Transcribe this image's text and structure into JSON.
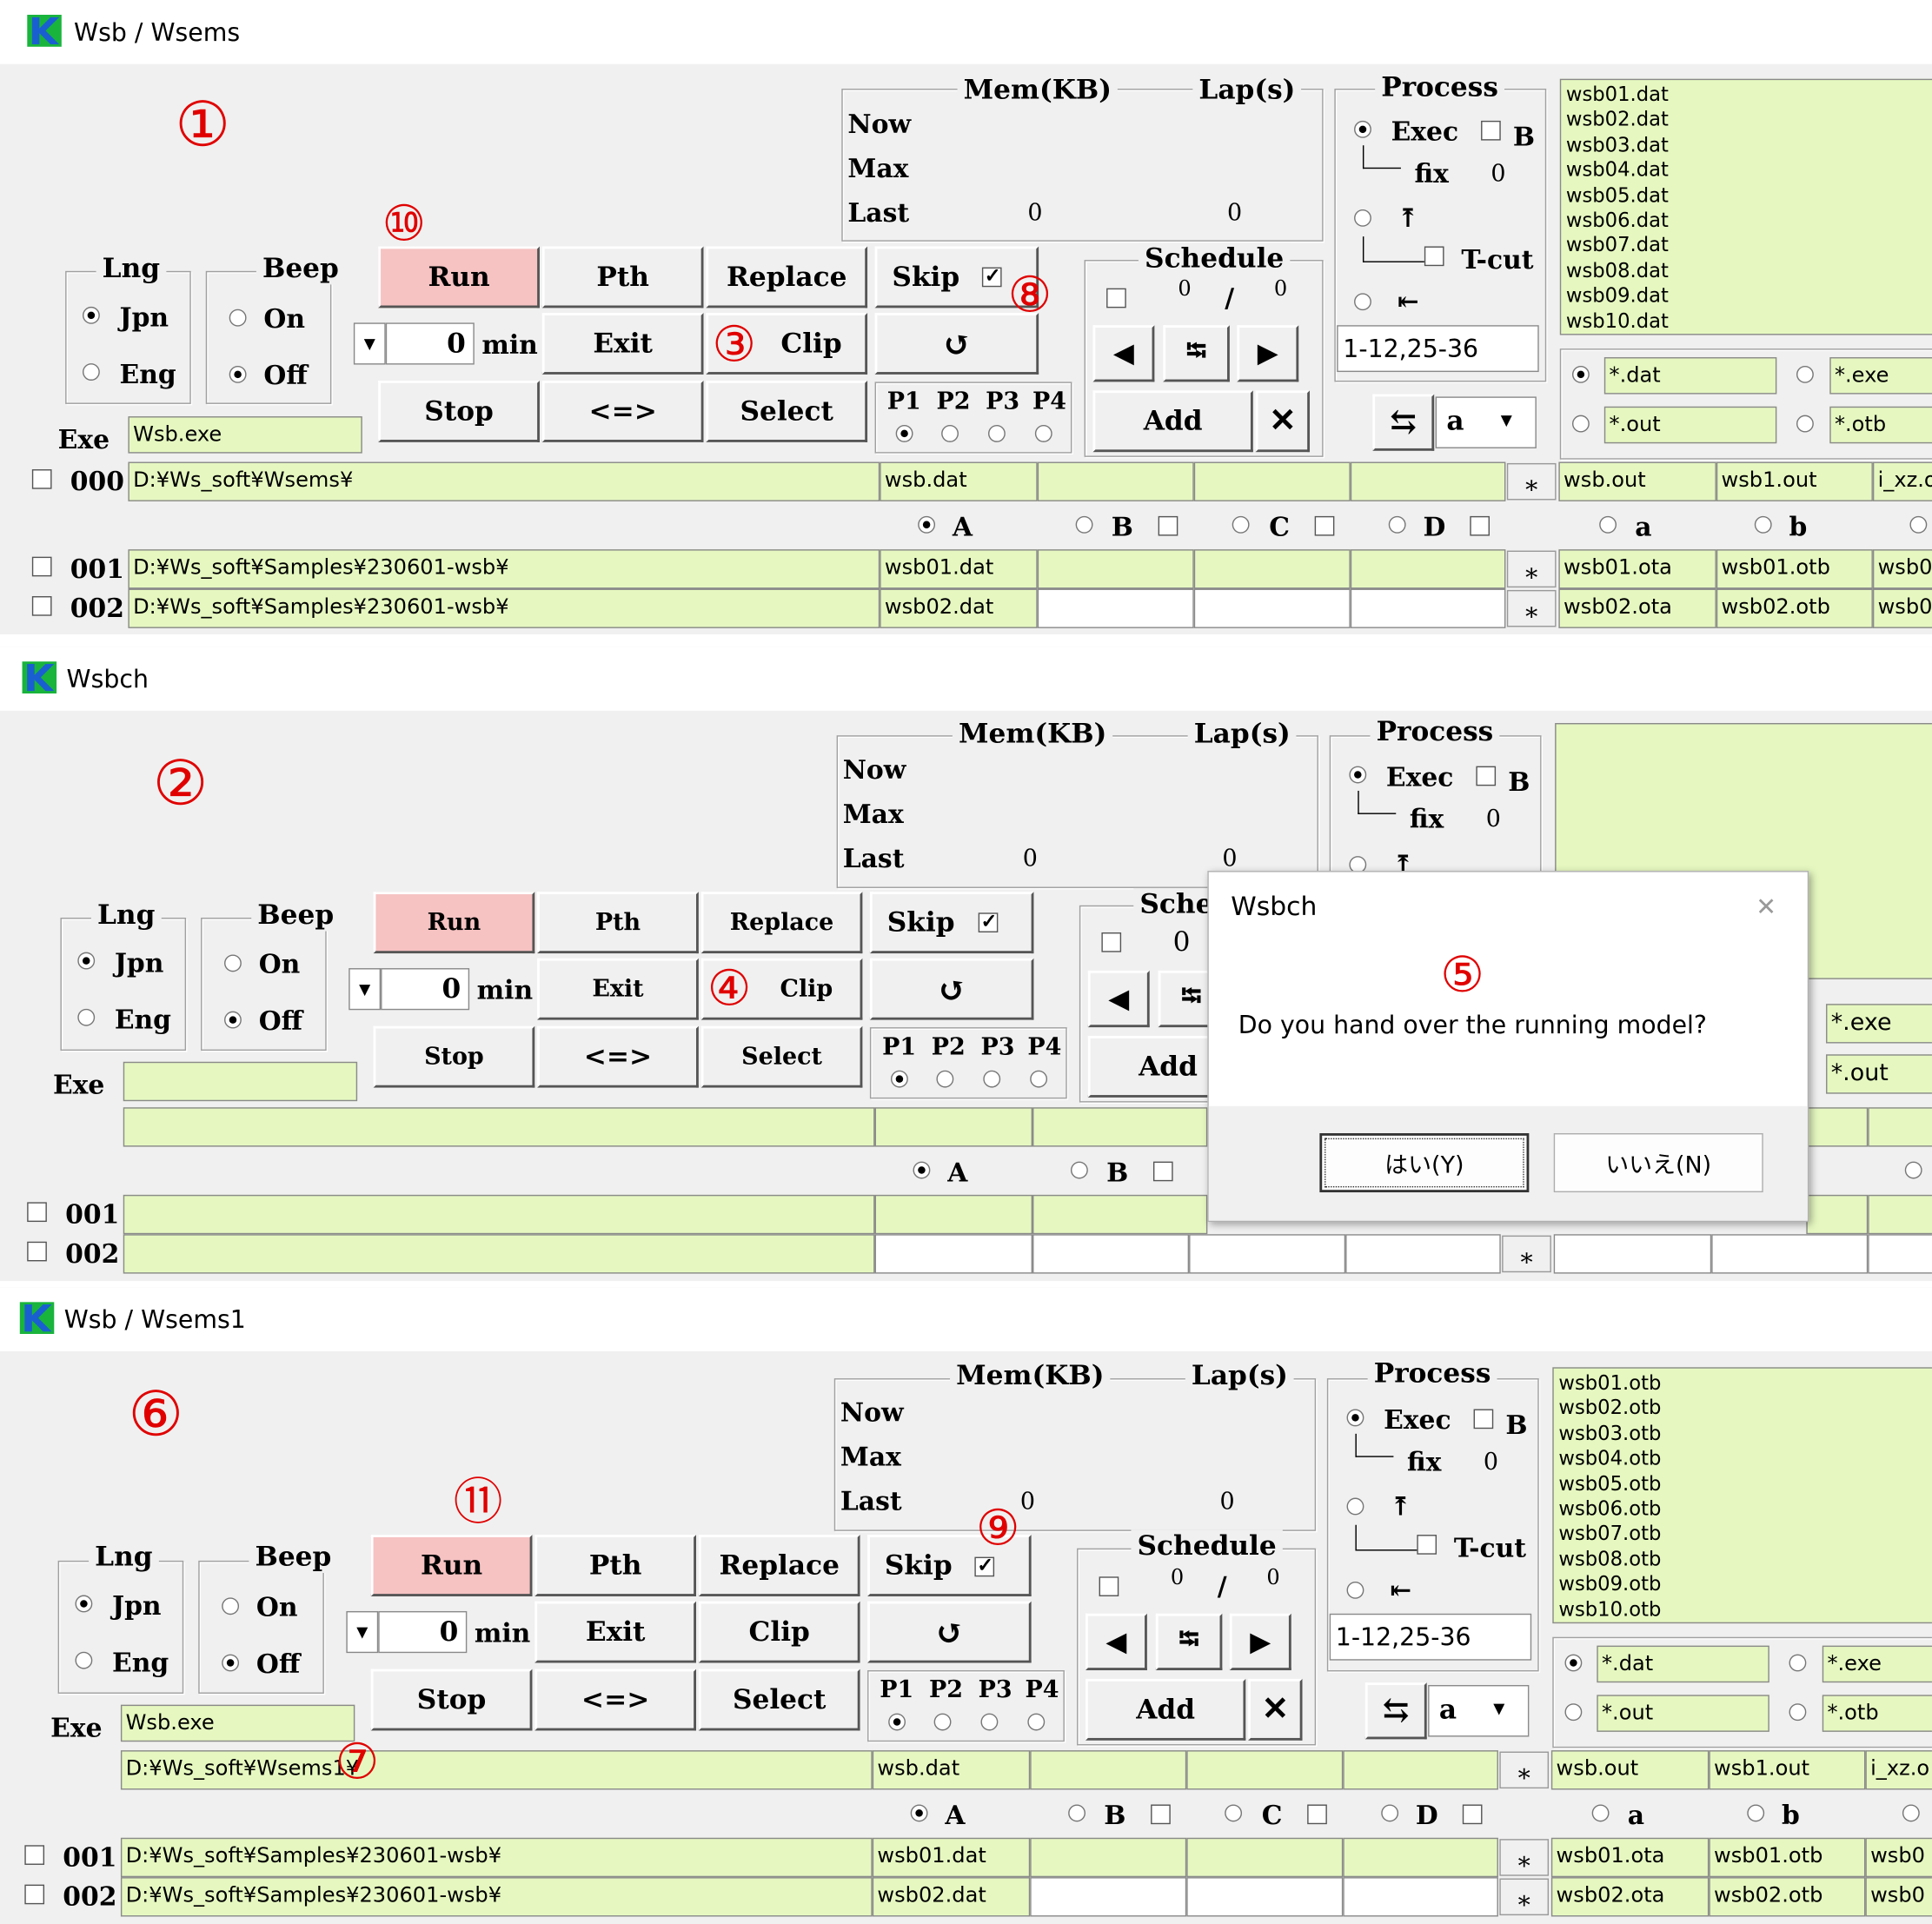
{
  "annotations": {
    "n1": "①",
    "n2": "②",
    "n3": "③",
    "n4": "④",
    "n5": "⑤",
    "n6": "⑥",
    "n7": "⑦",
    "n8": "⑧",
    "n9": "⑨",
    "n10": "⑩",
    "n11": "⑪"
  },
  "colors": {
    "field": "#e6f8c0",
    "run_button": "#f6c2c2",
    "annotation": "#e00000",
    "logo": "#1a5fd1"
  },
  "labels": {
    "mem": "Mem(KB)",
    "lap": "Lap(s)",
    "process": "Process",
    "now": "Now",
    "max": "Max",
    "last": "Last",
    "lng": "Lng",
    "beep": "Beep",
    "jpn": "Jpn",
    "eng": "Eng",
    "on": "On",
    "off": "Off",
    "exe": "Exe",
    "run": "Run",
    "pth": "Pth",
    "replace": "Replace",
    "skip": "Skip",
    "exit": "Exit",
    "clip": "Clip",
    "refresh": "↺",
    "stop": "Stop",
    "swap": "<=>",
    "select": "Select",
    "p1": "P1",
    "p2": "P2",
    "p3": "P3",
    "p4": "P4",
    "min": "min",
    "schedule": "Schedule",
    "schedule_short": "Sche",
    "add": "Add",
    "del": "✕",
    "exec": "Exec",
    "b_flag": "B",
    "fix": "fix",
    "tcut": "T-cut",
    "up_arrow": "⤒",
    "left_bar": "⇤",
    "col_a": "A",
    "col_b": "B",
    "col_c": "C",
    "col_d": "D",
    "col_sa": "a",
    "col_sb": "b",
    "star": "⁎",
    "zero": "0",
    "slash": "/",
    "swap_icon": "⇆",
    "first_icon": "◀",
    "last_icon": "▶",
    "mid_icon": "⭾"
  },
  "win1": {
    "title": "Wsb / Wsems",
    "last_mem": "0",
    "last_lap": "0",
    "fix_value": "0",
    "sched_a": "0",
    "sched_b": "0",
    "min_value": "0",
    "range": "1-12,25-36",
    "combo": "a",
    "filters": [
      "*.dat",
      "*.exe",
      "*.out",
      "*.otb"
    ],
    "list": [
      "wsb01.dat",
      "wsb02.dat",
      "wsb03.dat",
      "wsb04.dat",
      "wsb05.dat",
      "wsb06.dat",
      "wsb07.dat",
      "wsb08.dat",
      "wsb09.dat",
      "wsb10.dat"
    ],
    "exe": "Wsb.exe",
    "row0": {
      "id": "000",
      "path": "D:¥Ws_soft¥Wsems¥",
      "file": "wsb.dat",
      "o1": "wsb.out",
      "o2": "wsb1.out",
      "o3": "i_xz.o"
    },
    "rows": [
      {
        "id": "001",
        "path": "D:¥Ws_soft¥Samples¥230601-wsb¥",
        "file": "wsb01.dat",
        "o1": "wsb01.ota",
        "o2": "wsb01.otb",
        "o3": "wsb0"
      },
      {
        "id": "002",
        "path": "D:¥Ws_soft¥Samples¥230601-wsb¥",
        "file": "wsb02.dat",
        "o1": "wsb02.ota",
        "o2": "wsb02.otb",
        "o3": "wsb0"
      }
    ]
  },
  "win2": {
    "title": "Wsbch",
    "last_mem": "0",
    "last_lap": "0",
    "fix_value": "0",
    "sched_a": "0",
    "min_value": "0",
    "filters": [
      "*.exe",
      "*.out"
    ],
    "rows": [
      {
        "id": "001"
      },
      {
        "id": "002"
      }
    ],
    "dialog": {
      "title": "Wsbch",
      "message": "Do you hand over the running model?",
      "yes": "はい(Y)",
      "no": "いいえ(N)",
      "close": "✕"
    }
  },
  "win3": {
    "title": "Wsb / Wsems1",
    "last_mem": "0",
    "last_lap": "0",
    "fix_value": "0",
    "sched_a": "0",
    "sched_b": "0",
    "min_value": "0",
    "range": "1-12,25-36",
    "combo": "a",
    "filters": [
      "*.dat",
      "*.exe",
      "*.out",
      "*.otb"
    ],
    "list": [
      "wsb01.otb",
      "wsb02.otb",
      "wsb03.otb",
      "wsb04.otb",
      "wsb05.otb",
      "wsb06.otb",
      "wsb07.otb",
      "wsb08.otb",
      "wsb09.otb",
      "wsb10.otb"
    ],
    "exe": "Wsb.exe",
    "row0": {
      "path": "D:¥Ws_soft¥Wsems1¥",
      "file": "wsb.dat",
      "o1": "wsb.out",
      "o2": "wsb1.out",
      "o3": "i_xz.o"
    },
    "rows": [
      {
        "id": "001",
        "path": "D:¥Ws_soft¥Samples¥230601-wsb¥",
        "file": "wsb01.dat",
        "o1": "wsb01.ota",
        "o2": "wsb01.otb",
        "o3": "wsb0"
      },
      {
        "id": "002",
        "path": "D:¥Ws_soft¥Samples¥230601-wsb¥",
        "file": "wsb02.dat",
        "o1": "wsb02.ota",
        "o2": "wsb02.otb",
        "o3": "wsb0"
      }
    ]
  }
}
